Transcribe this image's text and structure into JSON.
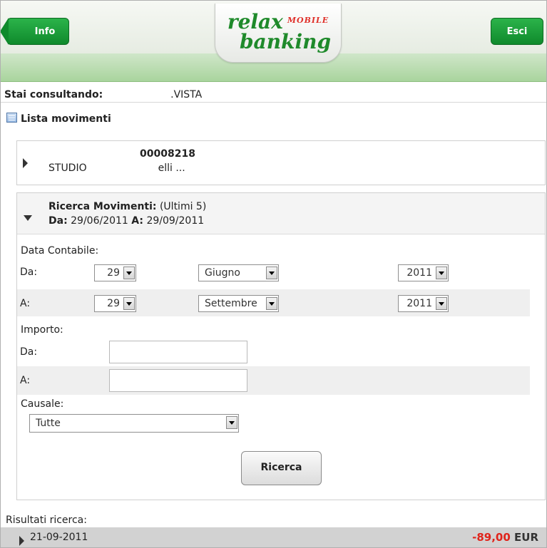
{
  "header": {
    "info_label": "Info",
    "exit_label": "Esci",
    "logo_line1": "relax",
    "logo_mobile": "MOBILE",
    "logo_line2": "banking"
  },
  "consulting": {
    "label": "Stai consultando:",
    "value": ".VISTA"
  },
  "section_title": "Lista movimenti",
  "account": {
    "number": "00008218",
    "name": "STUDIO",
    "name_suffix": "elli ..."
  },
  "search": {
    "title_label": "Ricerca Movimenti:",
    "title_note": "(Ultimi 5)",
    "from_label": "Da:",
    "from_date": "29/06/2011",
    "to_label": "A:",
    "to_date": "29/09/2011",
    "date_section_label": "Data Contabile:",
    "date_from_label": "Da:",
    "date_to_label": "A:",
    "date_from": {
      "day": "29",
      "month": "Giugno",
      "year": "2011"
    },
    "date_to": {
      "day": "29",
      "month": "Settembre",
      "year": "2011"
    },
    "amount_section_label": "Importo:",
    "amount_from_label": "Da:",
    "amount_to_label": "A:",
    "amount_from_value": "",
    "amount_to_value": "",
    "reason_label": "Causale:",
    "reason_value": "Tutte",
    "submit_label": "Ricerca"
  },
  "results": {
    "label": "Risultati ricerca:",
    "items": [
      {
        "date": "21-09-2011",
        "amount": "-89,00",
        "currency": "EUR"
      }
    ]
  },
  "colors": {
    "brand_green": "#1f8a2b",
    "negative_amount": "#e0241b"
  }
}
